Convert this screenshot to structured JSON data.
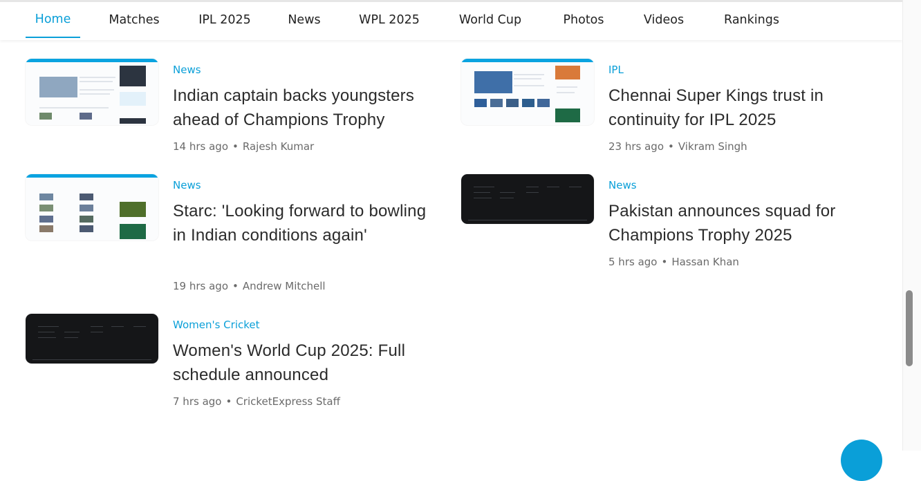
{
  "nav": {
    "tabs": [
      {
        "label": "Home",
        "active": true
      },
      {
        "label": "Matches"
      },
      {
        "label": "IPL 2025"
      },
      {
        "label": "News"
      },
      {
        "label": "WPL 2025"
      },
      {
        "label": "World Cup"
      },
      {
        "label": "Photos"
      },
      {
        "label": "Videos"
      },
      {
        "label": "Rankings"
      }
    ]
  },
  "articles": [
    {
      "category": "News",
      "title": "Indian captain backs youngsters ahead of Champions Trophy",
      "time": "14 hrs ago",
      "author": "Rajesh Kumar",
      "thumb_style": "light"
    },
    {
      "category": "IPL",
      "title": "Chennai Super Kings trust in continuity for IPL 2025",
      "time": "23 hrs ago",
      "author": "Vikram Singh",
      "thumb_style": "light"
    },
    {
      "category": "News",
      "title": "Starc: 'Looking forward to bowling in Indian conditions again'",
      "time": "19 hrs ago",
      "author": "Andrew Mitchell",
      "thumb_style": "light"
    },
    {
      "category": "News",
      "title": "Pakistan announces squad for Champions Trophy 2025",
      "time": "5 hrs ago",
      "author": "Hassan Khan",
      "thumb_style": "dark"
    },
    {
      "category": "Women's Cricket",
      "title": "Women's World Cup 2025: Full schedule announced",
      "time": "7 hrs ago",
      "author": "CricketExpress Staff",
      "thumb_style": "dark"
    }
  ],
  "meta_separator": "•",
  "colors": {
    "accent": "#0a9fd8",
    "text": "#2b2b2b",
    "muted": "#6a6a6a"
  }
}
